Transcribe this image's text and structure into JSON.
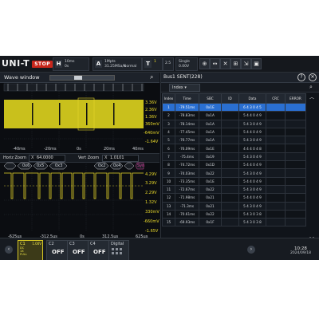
{
  "brand": "UNI-T",
  "run_state": "STOP",
  "toolbar": {
    "horizontal": {
      "key": "H",
      "line1": "10ms",
      "line2": "0s"
    },
    "acquire": {
      "key": "A",
      "line1": "1Mpts",
      "line2": "31.25MSa/s",
      "mode": "Normal"
    },
    "trigger": {
      "key": "T",
      "channel": "1",
      "level": "2.5"
    },
    "single": {
      "label": "Single",
      "value": "0.00V"
    },
    "icons": [
      "measure-icon",
      "cursor-icon",
      "x-icon",
      "math-icon",
      "zoom-icon",
      "save-icon"
    ]
  },
  "wave_window": {
    "title": "Wave window",
    "main_volts": [
      "3.36V",
      "2.36V",
      "1.36V",
      "360mV",
      "-640mV",
      "-1.64V"
    ],
    "main_times": [
      "-40ms",
      "-20ms",
      "0s",
      "20ms",
      "40ms"
    ],
    "horz_zoom_label": "Horiz Zoom",
    "horz_zoom_value": "64.0000",
    "vert_zoom_label": "Vert Zoom",
    "vert_zoom_value": "1.0101",
    "zoom_volts": [
      "4.29V",
      "3.29V",
      "2.29V",
      "1.32V",
      "330mV",
      "-660mV",
      "-1.65V"
    ],
    "zoom_times": [
      "-625μs",
      "-312.5μs",
      "0s",
      "312.5μs",
      "625μs"
    ],
    "decode_boxes": [
      "0x6",
      "0x5",
      "0x3",
      "0x0",
      "0x2",
      "0x4",
      "0x4",
      "Syn"
    ]
  },
  "bus_table": {
    "title": "Bus1 SENT(228)",
    "search_mode": "Index",
    "columns": [
      "Index",
      "Time",
      "SBC",
      "ID",
      "Data",
      "CRC",
      "ERROR"
    ],
    "rows": [
      {
        "index": "1",
        "time": "-79.51ms",
        "sbc": "0x1E",
        "id": "",
        "data": "6 4 3 0 4 5",
        "crc": "",
        "error": ""
      },
      {
        "index": "2",
        "time": "-78.83ms",
        "sbc": "0x1A",
        "id": "",
        "data": "5 4 4 0 4 9",
        "crc": "",
        "error": ""
      },
      {
        "index": "3",
        "time": "-78.14ms",
        "sbc": "0x1A",
        "id": "",
        "data": "5 4 3 0 4 9",
        "crc": "",
        "error": ""
      },
      {
        "index": "4",
        "time": "-77.45ms",
        "sbc": "0x1A",
        "id": "",
        "data": "5 4 4 0 4 9",
        "crc": "",
        "error": ""
      },
      {
        "index": "5",
        "time": "-76.77ms",
        "sbc": "0x1A",
        "id": "",
        "data": "5 4 3 0 4 9",
        "crc": "",
        "error": ""
      },
      {
        "index": "6",
        "time": "-76.09ms",
        "sbc": "0x1E",
        "id": "",
        "data": "4 4 4 0 4 8",
        "crc": "",
        "error": ""
      },
      {
        "index": "7",
        "time": "-75.4ms",
        "sbc": "0x19",
        "id": "",
        "data": "5 4 3 0 4 9",
        "crc": "",
        "error": ""
      },
      {
        "index": "8",
        "time": "-74.72ms",
        "sbc": "0x1D",
        "id": "",
        "data": "5 4 4 0 4 9",
        "crc": "",
        "error": ""
      },
      {
        "index": "9",
        "time": "-74.03ms",
        "sbc": "0x22",
        "id": "",
        "data": "5 4 3 0 4 9",
        "crc": "",
        "error": ""
      },
      {
        "index": "10",
        "time": "-73.35ms",
        "sbc": "0x1E",
        "id": "",
        "data": "5 4 4 0 4 9",
        "crc": "",
        "error": ""
      },
      {
        "index": "11",
        "time": "-72.67ms",
        "sbc": "0x22",
        "id": "",
        "data": "5 4 3 0 4 9",
        "crc": "",
        "error": ""
      },
      {
        "index": "12",
        "time": "-71.98ms",
        "sbc": "0x21",
        "id": "",
        "data": "5 4 4 0 4 9",
        "crc": "",
        "error": ""
      },
      {
        "index": "13",
        "time": "-71.3ms",
        "sbc": "0x21",
        "id": "",
        "data": "5 4 3 0 4 9",
        "crc": "",
        "error": ""
      },
      {
        "index": "14",
        "time": "-70.61ms",
        "sbc": "0x22",
        "id": "",
        "data": "5 4 3 0 3 8",
        "crc": "",
        "error": ""
      },
      {
        "index": "15",
        "time": "-69.93ms",
        "sbc": "0x1F",
        "id": "",
        "data": "5 4 3 0 3 8",
        "crc": "",
        "error": ""
      }
    ]
  },
  "channels": [
    {
      "name": "C1",
      "state": "",
      "info": "DC\n1X\nFULL",
      "volts": "1.00V",
      "active": true
    },
    {
      "name": "C2",
      "state": "OFF",
      "active": false
    },
    {
      "name": "C3",
      "state": "OFF",
      "active": false
    },
    {
      "name": "C4",
      "state": "OFF",
      "active": false
    }
  ],
  "digital_label": "Digital",
  "clock": {
    "time": "10:28",
    "date": "2024/09/18"
  },
  "colors": {
    "ch1": "#e8d82a",
    "ch1_fill": "#c9c01c",
    "selected_row": "#2a6fd1",
    "stop": "#c8261b"
  }
}
